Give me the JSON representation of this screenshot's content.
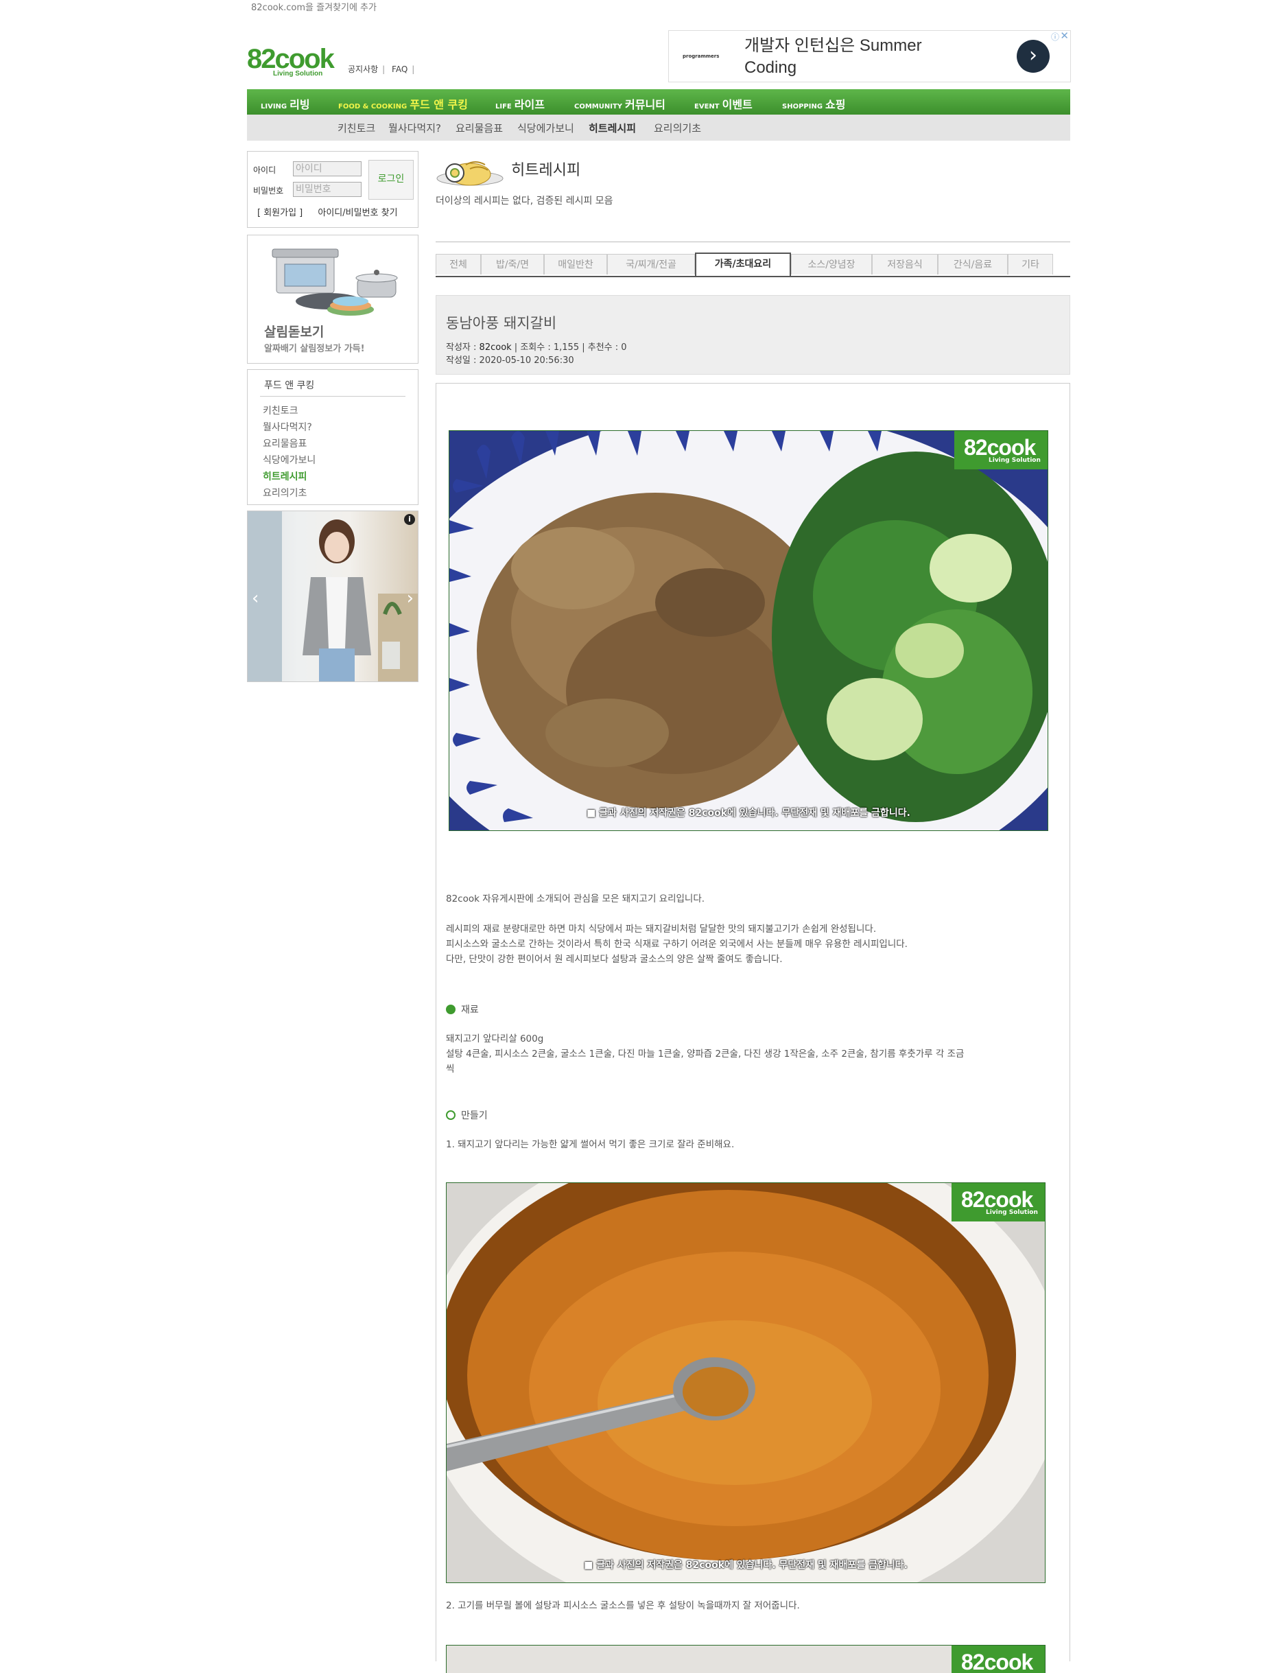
{
  "bookmark": "82cook.com을 즐겨찾기에 추가",
  "logo": {
    "main": "82cook",
    "sub": "Living Solution"
  },
  "top_links": [
    "공지사항",
    "FAQ"
  ],
  "ad": {
    "brand": "programmers",
    "text": "개발자 인턴십은 Summer Coding",
    "next": "›",
    "info": "ⓘ",
    "close": "✕"
  },
  "main_nav": [
    {
      "en": "LIVING",
      "ko": "리빙"
    },
    {
      "en": "FOOD & COOKING",
      "ko": "푸드 앤 쿠킹"
    },
    {
      "en": "LIFE",
      "ko": "라이프"
    },
    {
      "en": "COMMUNITY",
      "ko": "커뮤니티"
    },
    {
      "en": "EVENT",
      "ko": "이벤트"
    },
    {
      "en": "SHOPPING",
      "ko": "쇼핑"
    }
  ],
  "sub_nav": [
    "키친토크",
    "뭘사다먹지?",
    "요리물음표",
    "식당에가보니",
    "히트레시피",
    "요리의기초"
  ],
  "login": {
    "id_label": "아이디",
    "id_placeholder": "아이디",
    "pw_label": "비밀번호",
    "pw_placeholder": "비밀번호",
    "button": "로그인",
    "join": "[ 회원가입 ]",
    "find": "아이디/비밀번호 찾기"
  },
  "promo": {
    "title": "살림돋보기",
    "subtitle": "알짜배기 살림정보가 가득!"
  },
  "category": {
    "title": "푸드 앤 쿠킹",
    "items": [
      "키친토크",
      "뭘사다먹지?",
      "요리물음표",
      "식당에가보니",
      "히트레시피",
      "요리의기초"
    ]
  },
  "sidebanner": {
    "prev": "‹",
    "next": "›",
    "info": "i"
  },
  "board": {
    "title": "히트레시피",
    "description": "더이상의 레시피는 없다, 검증된 레시피 모음"
  },
  "tabs": [
    "전체",
    "밥/죽/면",
    "매일반찬",
    "국/찌개/전골",
    "가족/초대요리",
    "소스/양념장",
    "저장음식",
    "간식/음료",
    "기타"
  ],
  "post": {
    "title": "동남아풍 돼지갈비",
    "author_label": "작성자 :",
    "author": "82cook",
    "views_label": "조회수 :",
    "views": "1,155",
    "recommend_label": "추천수 :",
    "recommend": "0",
    "date_label": "작성일 :",
    "date": "2020-05-10 20:56:30"
  },
  "watermark": {
    "logo": "82cook",
    "sub": "Living Solution",
    "note": "■ 글과 사진의 저작권은 82cook에 있습니다. 무단전재 및 재배포를 금합니다."
  },
  "body": {
    "intro": "82cook 자유게시판에 소개되어 관심을 모은 돼지고기 요리입니다.",
    "p1": "레시피의 재료 분량대로만 하면 마치 식당에서 파는  돼지갈비처럼 달달한 맛의 돼지불고기가 손쉽게 완성됩니다.",
    "p2": "피시소스와 굴소스로 간하는 것이라서 특히 한국 식재료 구하기 어려운 외국에서 사는 분들께 매우 유용한 레시피입니다.",
    "p3": "다만, 단맛이 강한 편이어서 원 레시피보다 설탕과 굴소스의 양은 살짝 줄여도 좋습니다.",
    "ingredients_heading": "재료",
    "ing1": "돼지고기 앞다리살 600g",
    "ing2a": "설탕 4큰술, 피시소스 2큰술, 굴소스 1큰술, 다진 마늘 1큰술, 양파즙 2큰술, 다진 생강 1작은술, 소주 2큰술, 참기름 후춧가루 각 조금",
    "ing2b": "씩",
    "method_heading": "만들기",
    "step1": "1. 돼지고기 앞다리는 가능한 얇게 썰어서 먹기 좋은 크기로 잘라 준비해요.",
    "step2": "2. 고기를 버무릴 볼에 설탕과 피시소스 굴소스를 넣은 후 설탕이 녹을때까지 잘 저어줍니다."
  }
}
